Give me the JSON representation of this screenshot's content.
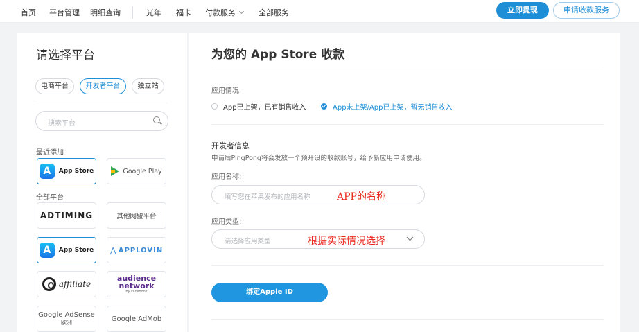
{
  "nav": {
    "items": [
      "首页",
      "平台管理",
      "明细查询",
      "光年",
      "福卡",
      "付款服务",
      "全部服务"
    ],
    "withdraw_label": "立即提现",
    "apply_label": "申请收款服务"
  },
  "sidebar": {
    "title": "请选择平台",
    "chips": [
      {
        "label": "电商平台",
        "active": false
      },
      {
        "label": "开发者平台",
        "active": true
      },
      {
        "label": "独立站",
        "active": false
      }
    ],
    "search_placeholder": "搜索平台",
    "recent_label": "最近添加",
    "all_label": "全部平台",
    "recent": [
      {
        "name": "App Store",
        "icon": "app-store-icon",
        "selected": true
      },
      {
        "name": "Google Play",
        "icon": "google-play-icon",
        "selected": false
      }
    ],
    "platforms": [
      {
        "name": "ADTIMING",
        "selected": false
      },
      {
        "name": "其他网盟平台",
        "selected": false
      },
      {
        "name": "App Store",
        "selected": true
      },
      {
        "name": "APPLOVIN",
        "selected": false
      },
      {
        "name": "affiliate",
        "selected": false
      },
      {
        "name": "audience network",
        "sub": "by Facebook",
        "selected": false
      },
      {
        "name": "Google AdSense",
        "sub": "欧洲",
        "selected": false
      },
      {
        "name": "Google AdMob",
        "selected": false
      }
    ]
  },
  "main": {
    "title": "为您的 App Store 收款",
    "app_status_label": "应用情况",
    "options": [
      {
        "label": "App已上架，已有销售收入",
        "checked": false
      },
      {
        "label": "App未上架/App已上架，暂无销售收入",
        "checked": true
      }
    ],
    "dev_info_title": "开发者信息",
    "dev_info_desc": "申请后PingPong将会发放一个预开设的收款账号，给予新应用申请使用。",
    "app_name_label": "应用名称:",
    "app_name_placeholder": "填写您在苹果发布的应用名称",
    "app_name_annotation": "APP的名称",
    "app_type_label": "应用类型:",
    "app_type_placeholder": "请选择应用类型",
    "app_type_annotation": "根据实际情况选择",
    "bind_button": "绑定Apple ID"
  },
  "colors": {
    "primary": "#1e8fd6",
    "annotation": "#e8281e",
    "background": "#f2f3f5"
  }
}
